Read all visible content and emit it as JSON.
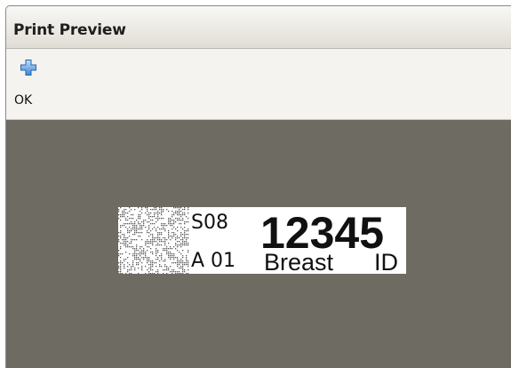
{
  "window": {
    "title": "Print Preview"
  },
  "toolbar": {
    "ok_label": "OK",
    "ok_icon": "plus-icon"
  },
  "label": {
    "code_line1": "S08",
    "code_line2": "A 01",
    "number": "12345",
    "tissue": "Breast",
    "id_text": "ID"
  },
  "colors": {
    "preview_background": "#6e6c62",
    "plus_icon": "#4a90d9"
  }
}
